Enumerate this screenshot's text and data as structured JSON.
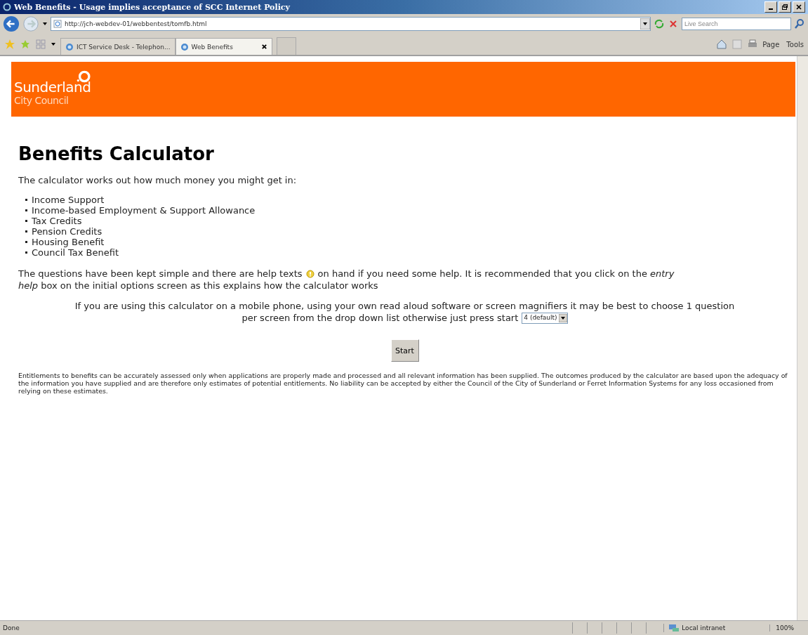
{
  "window": {
    "title": "Web Benefits - Usage implies acceptance of SCC Internet Policy"
  },
  "address_bar": {
    "url": "http://jch-webdev-01/webbentest/tomfb.html"
  },
  "search": {
    "placeholder": "Live Search"
  },
  "tabs": [
    {
      "label": "ICT Service Desk - Telephon...",
      "selected": false
    },
    {
      "label": "Web Benefits",
      "selected": true
    }
  ],
  "command_bar": [
    "Page",
    "Tools"
  ],
  "page": {
    "logo": {
      "line_1": "Sunderland",
      "line_2": "City Council"
    },
    "heading": "Benefits Calculator",
    "intro": "The calculator works out how much money you might get in:",
    "benefits": [
      "Income Support",
      "Income-based Employment & Support Allowance",
      "Tax Credits",
      "Pension Credits",
      "Housing Benefit",
      "Council Tax Benefit"
    ],
    "help_text_before": "The questions have been kept simple and there are help texts",
    "help_text_after": "on hand if you need some help. It is recommended that you click on the *entry*",
    "help_text_line_2": "*help* box on the initial options screen as this explains how the calculator works",
    "mobile_text_line_1": "If you are using this calculator on a mobile phone, using your own read aloud software or screen magnifiers it may be best to choose 1 question",
    "mobile_text_line_2": "per screen from the drop down list otherwise just press start",
    "questions_dropdown": "4 (default)",
    "start_button": "Start",
    "disclaimer": "Entitlements to benefits can be accurately assessed only when applications are properly made and processed and all relevant information has been supplied. The outcomes produced by the calculator are based upon the adequacy of the information you have supplied and are therefore only estimates of potential entitlements. No liability can be accepted by either the Council of the City of Sunderland or Ferret Information Systems for any loss occasioned from relying on these estimates."
  },
  "status_bar": {
    "status": "Done",
    "zone": "Local intranet",
    "zoom": "100%"
  }
}
